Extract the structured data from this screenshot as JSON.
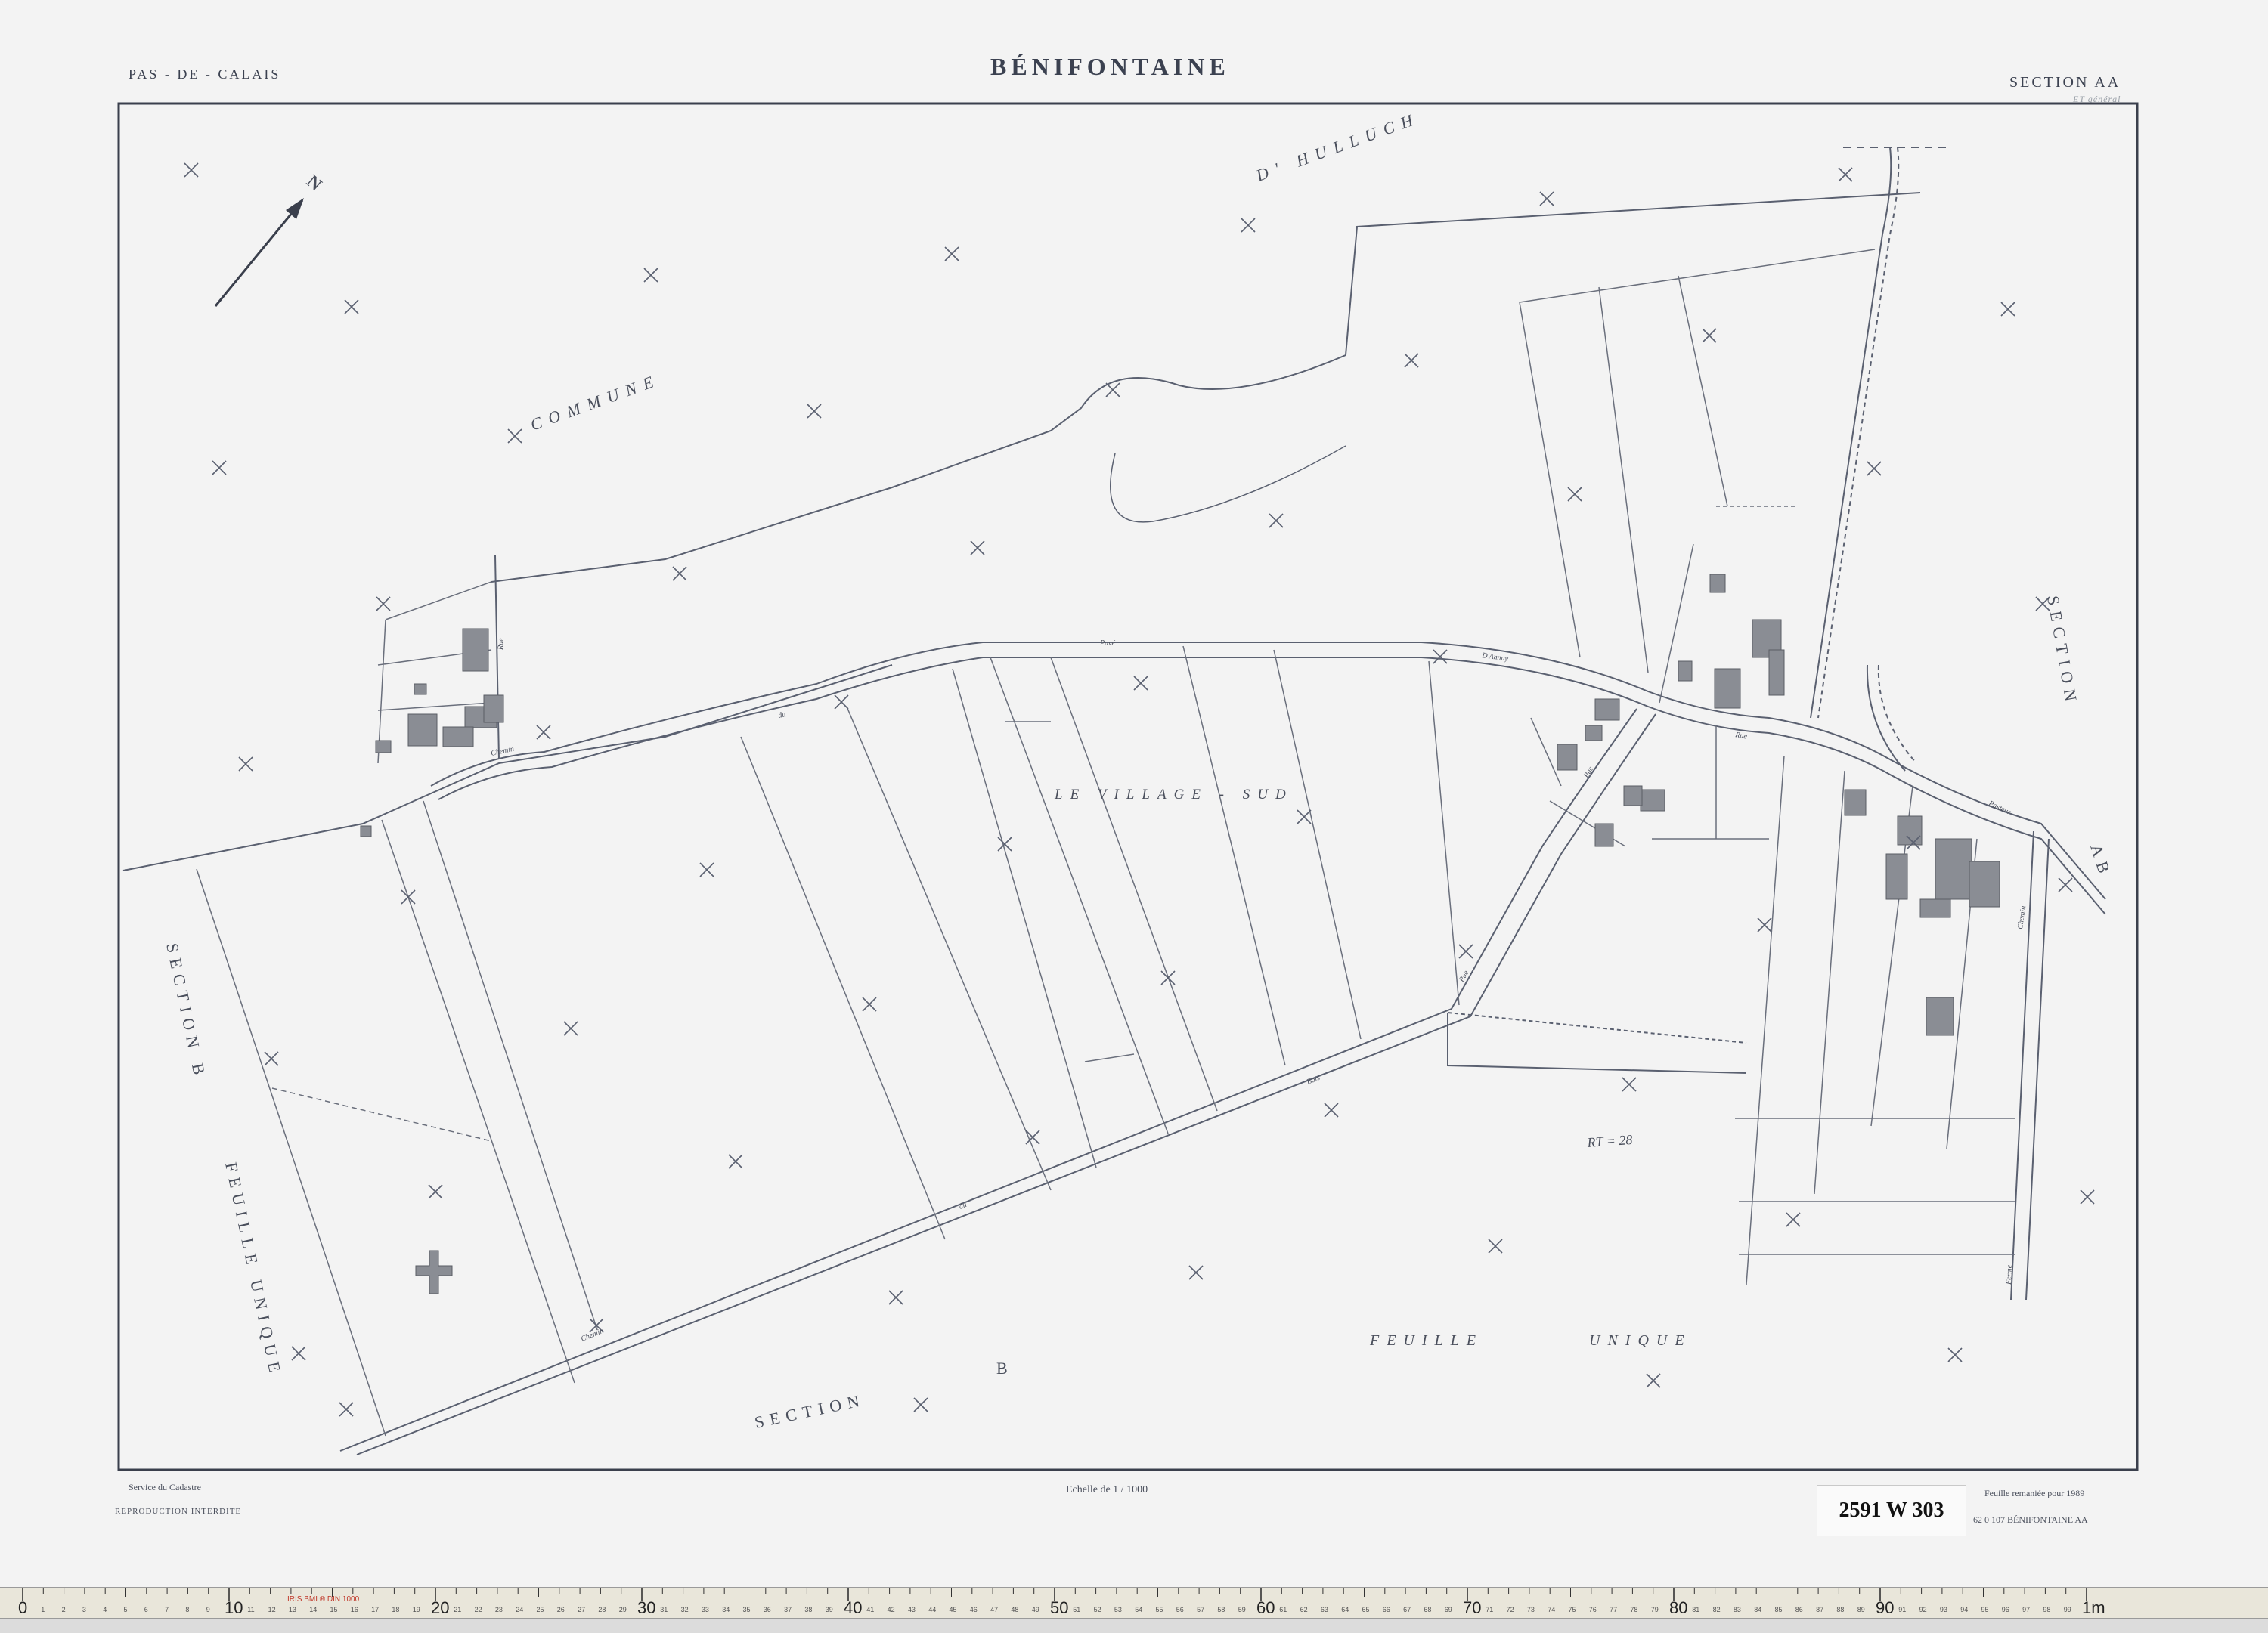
{
  "header": {
    "left": "PAS - DE - CALAIS",
    "title": "BÉNIFONTAINE",
    "right": "SECTION  AA",
    "right_annotation": "ET général"
  },
  "map_labels": {
    "commune": "COMMUNE",
    "hulluch": "D' HULLUCH",
    "village_sud": "LE VILLAGE - SUD",
    "section_right": "SECTION",
    "section_ab": "AB",
    "section_b_left": "SECTION B",
    "feuille_unique_left": "FEUILLE UNIQUE",
    "section_bottom": "SECTION",
    "b_bottom": "B",
    "feuille": "FEUILLE",
    "unique": "UNIQUE",
    "north": "N",
    "pencil_note": "RT = 28",
    "streets": [
      "Pavé",
      "D'Annay",
      "du",
      "Chemin",
      "Rue",
      "du",
      "Bois",
      "Chemin",
      "Rue",
      "Pasteur",
      "Chemin",
      "Rue",
      "Rue",
      "Ferme"
    ]
  },
  "footer": {
    "service": "Service du Cadastre",
    "reproduction": "REPRODUCTION  INTERDITE",
    "scale": "Echelle de 1 / 1000",
    "remaniee": "Feuille remaniée pour 1989",
    "ref": "62 0 107  BÉNIFONTAINE  AA",
    "archive_label": "2591 W 303"
  },
  "ruler": {
    "major_labels": [
      "0",
      "10",
      "20",
      "30",
      "40",
      "50",
      "60",
      "70",
      "80",
      "90",
      "1m"
    ],
    "stamp": "IRIS  BMI  ®  DIN 1000"
  },
  "colors": {
    "paper": "#f3f3f3",
    "line": "#5a6070",
    "building": "#8a8d94",
    "ruler": "#e9e6da",
    "ruler_red": "#c0392b"
  }
}
